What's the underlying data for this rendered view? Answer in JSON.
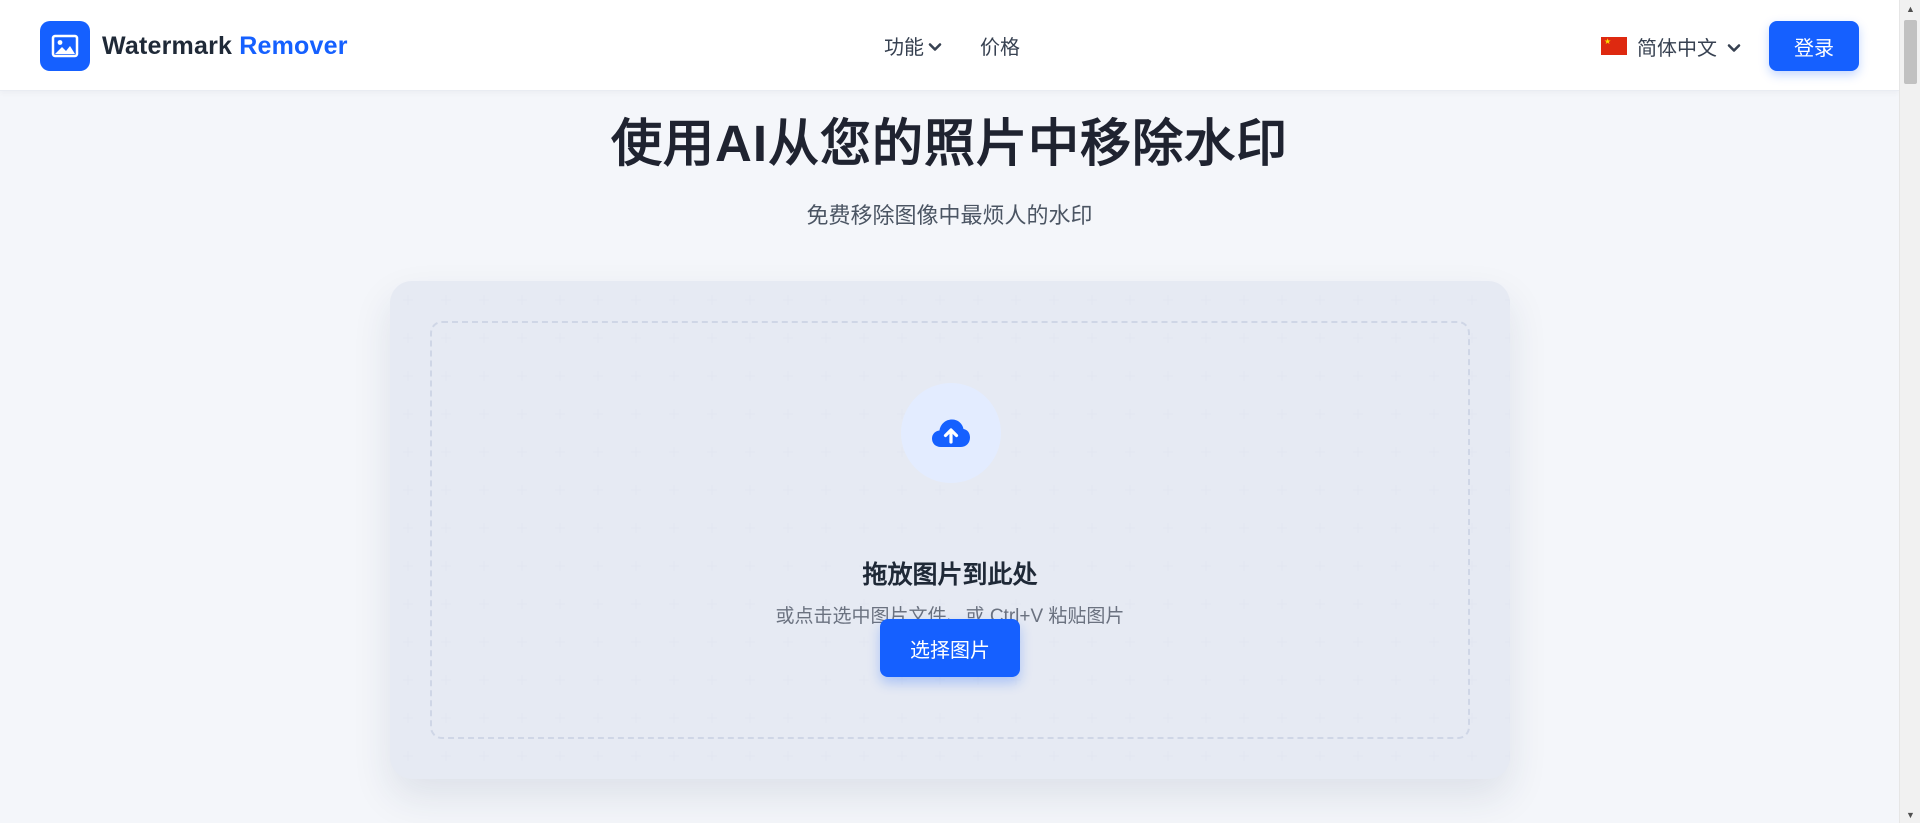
{
  "header": {
    "logo_text_main": "Watermark",
    "logo_text_accent": "Remover",
    "nav": [
      {
        "label": "功能",
        "has_dropdown": true
      },
      {
        "label": "价格",
        "has_dropdown": false
      }
    ],
    "language": "简体中文",
    "login_label": "登录"
  },
  "hero": {
    "title": "使用AI从您的照片中移除水印",
    "subtitle": "免费移除图像中最烦人的水印"
  },
  "upload": {
    "drop_title": "拖放图片到此处",
    "drop_hint": "或点击选中图片文件、或 Ctrl+V 粘贴图片",
    "select_button": "选择图片"
  },
  "icons": {
    "logo": "image-icon",
    "upload": "cloud-upload-icon",
    "dropdown": "chevron-down-icon",
    "flag": "china-flag-icon"
  },
  "colors": {
    "primary": "#1560ff",
    "page_background": "#f4f6fa",
    "upload_circle": "#e3ecff",
    "title_text": "#1f2330"
  }
}
